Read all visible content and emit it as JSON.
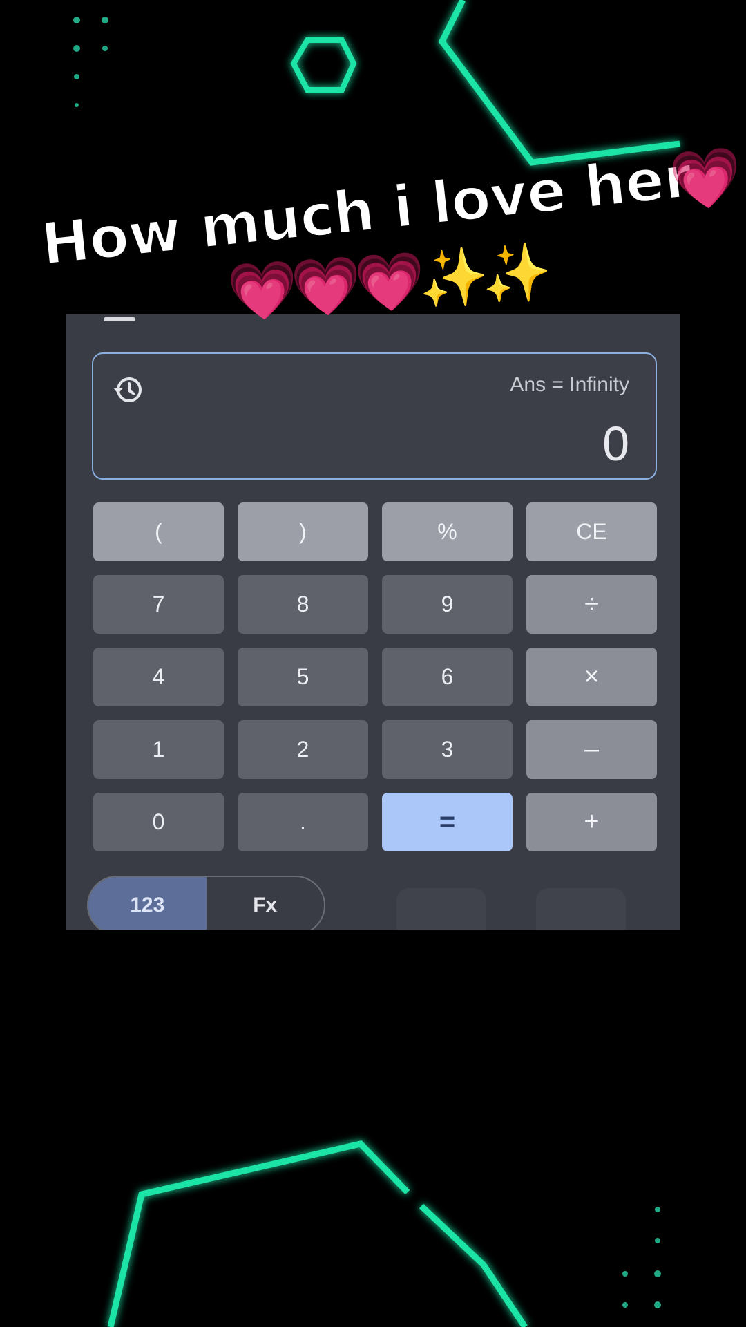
{
  "caption": {
    "line1": "How much i love her",
    "heart_end": "💗",
    "line2": "💗💗💗✨✨"
  },
  "calculator": {
    "history_icon": "history-icon",
    "ans_text": "Ans = Infinity",
    "result": "0",
    "keys": [
      {
        "label": "(",
        "kind": "fn"
      },
      {
        "label": ")",
        "kind": "fn"
      },
      {
        "label": "%",
        "kind": "fn"
      },
      {
        "label": "CE",
        "kind": "fn"
      },
      {
        "label": "7",
        "kind": "num"
      },
      {
        "label": "8",
        "kind": "num"
      },
      {
        "label": "9",
        "kind": "num"
      },
      {
        "label": "÷",
        "kind": "op"
      },
      {
        "label": "4",
        "kind": "num"
      },
      {
        "label": "5",
        "kind": "num"
      },
      {
        "label": "6",
        "kind": "num"
      },
      {
        "label": "×",
        "kind": "op"
      },
      {
        "label": "1",
        "kind": "num"
      },
      {
        "label": "2",
        "kind": "num"
      },
      {
        "label": "3",
        "kind": "num"
      },
      {
        "label": "–",
        "kind": "op"
      },
      {
        "label": "0",
        "kind": "num"
      },
      {
        "label": ".",
        "kind": "num"
      },
      {
        "label": "=",
        "kind": "eq"
      },
      {
        "label": "+",
        "kind": "op"
      }
    ],
    "mode": {
      "numeric_label": "123",
      "functions_label": "Fx",
      "active": "123"
    }
  },
  "colors": {
    "background": "#000000",
    "neon": "#1fe3a6",
    "panel": "#3a3c45",
    "display_border": "#8aaee0",
    "equals_key": "#abc6f8"
  }
}
